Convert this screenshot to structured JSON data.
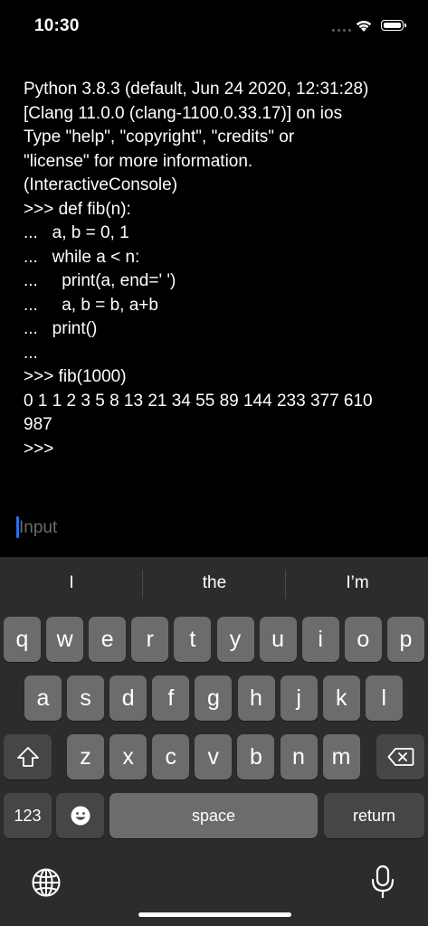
{
  "status_bar": {
    "time": "10:30"
  },
  "console": {
    "lines": [
      "Python 3.8.3 (default, Jun 24 2020, 12:31:28)",
      "[Clang 11.0.0 (clang-1100.0.33.17)] on ios",
      "Type \"help\", \"copyright\", \"credits\" or",
      "\"license\" for more information.",
      "(InteractiveConsole)",
      ">>> def fib(n):",
      "...   a, b = 0, 1",
      "...   while a < n:",
      "...     print(a, end=' ')",
      "...     a, b = b, a+b",
      "...   print()",
      "...",
      ">>> fib(1000)",
      "0 1 1 2 3 5 8 13 21 34 55 89 144 233 377 610",
      "987",
      ">>>"
    ]
  },
  "input": {
    "placeholder": "Input",
    "value": ""
  },
  "keyboard": {
    "suggestions": [
      "I",
      "the",
      "I’m"
    ],
    "row1": [
      "q",
      "w",
      "e",
      "r",
      "t",
      "y",
      "u",
      "i",
      "o",
      "p"
    ],
    "row2": [
      "a",
      "s",
      "d",
      "f",
      "g",
      "h",
      "j",
      "k",
      "l"
    ],
    "row3": [
      "z",
      "x",
      "c",
      "v",
      "b",
      "n",
      "m"
    ],
    "numbers_label": "123",
    "space_label": "space",
    "return_label": "return",
    "icons": {
      "shift": "shift-icon",
      "delete": "delete-icon",
      "emoji": "emoji-icon",
      "globe": "globe-icon",
      "mic": "microphone-icon"
    }
  }
}
